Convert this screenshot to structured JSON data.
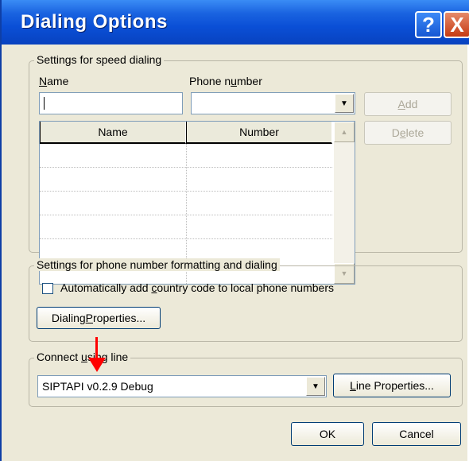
{
  "window": {
    "title": "Dialing Options",
    "help_glyph": "?",
    "close_glyph": "X"
  },
  "speed_dialing": {
    "legend": "Settings for speed dialing",
    "name_label_pre": "",
    "name_label_u": "N",
    "name_label_post": "ame",
    "phone_label_pre": "Phone n",
    "phone_label_u": "u",
    "phone_label_post": "mber",
    "name_value": "",
    "phone_value": "",
    "add_pre": "",
    "add_u": "A",
    "add_post": "dd",
    "delete_pre": "D",
    "delete_u": "e",
    "delete_post": "lete",
    "columns": [
      "Name",
      "Number"
    ]
  },
  "formatting": {
    "legend": "Settings for phone number formatting and dialing",
    "checkbox_pre": "Automatically add ",
    "checkbox_u": "c",
    "checkbox_post": "ountry code to local phone numbers",
    "checkbox_checked": false,
    "dialing_pre": "Dialing ",
    "dialing_u": "P",
    "dialing_post": "roperties..."
  },
  "connect": {
    "legend_pre": "Connect ",
    "legend_u": "u",
    "legend_post": "sing line",
    "line_value": "SIPTAPI v0.2.9 Debug",
    "line_props_pre": "",
    "line_props_u": "L",
    "line_props_post": "ine Properties..."
  },
  "footer": {
    "ok": "OK",
    "cancel": "Cancel"
  },
  "colors": {
    "annotation_arrow": "#ff0000"
  }
}
